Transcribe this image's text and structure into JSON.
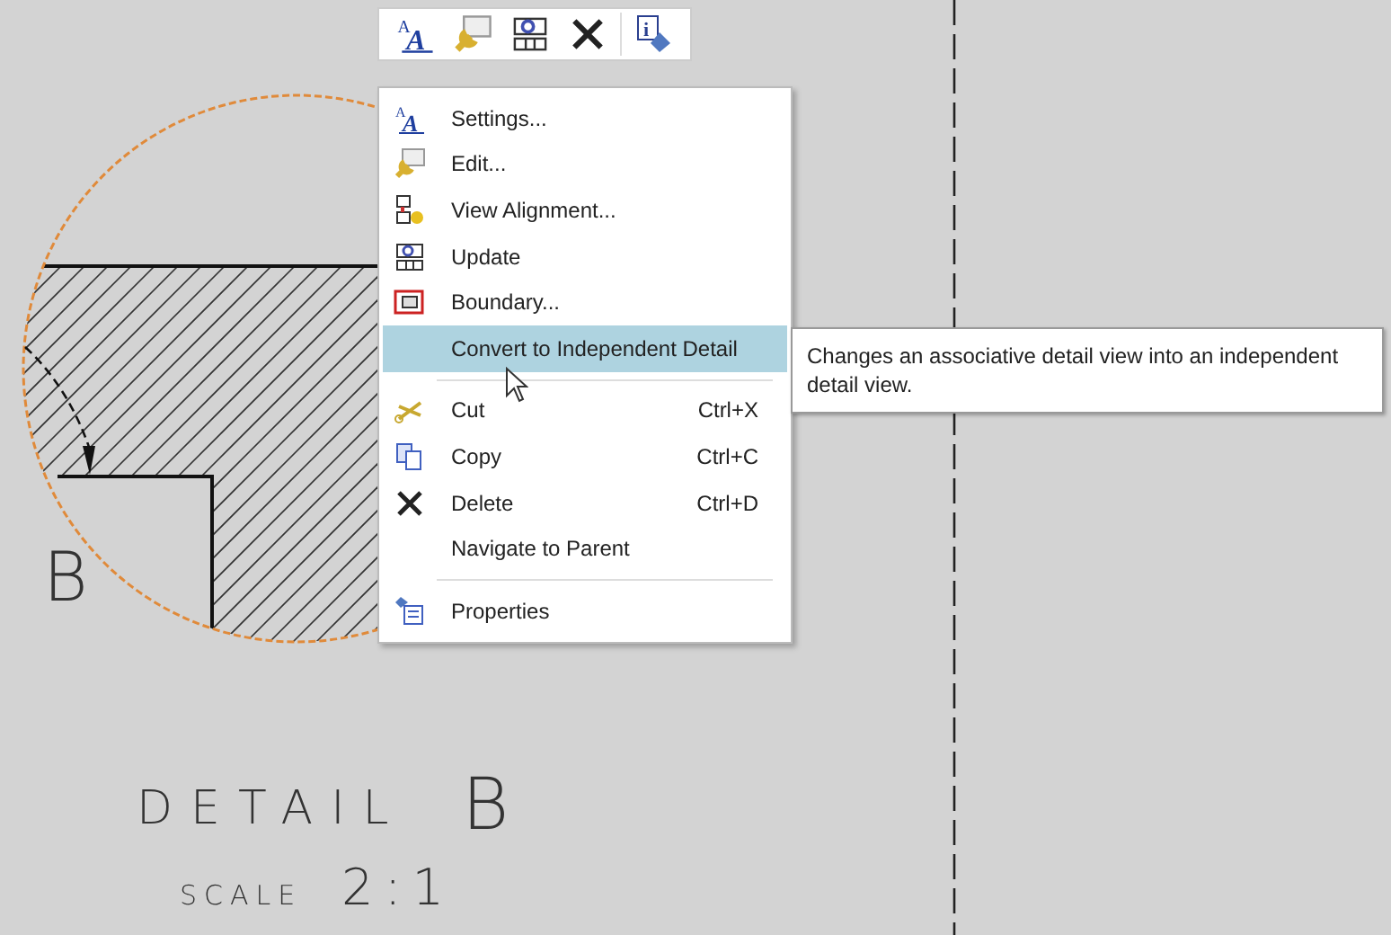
{
  "drawing": {
    "view_label": "B",
    "title_word": "DETAIL",
    "title_letter": "B",
    "scale_word": "SCALE",
    "scale_value": "2:1"
  },
  "mini_toolbar": {
    "buttons": [
      {
        "kind": "font",
        "letters": [
          "A",
          "A"
        ]
      },
      {
        "kind": "edit"
      },
      {
        "kind": "update"
      },
      {
        "kind": "delete"
      },
      {
        "kind": "info",
        "letters": [
          "i"
        ]
      }
    ]
  },
  "context_menu": {
    "items": [
      {
        "kind": "item",
        "label": "Settings...",
        "icon_letters": [
          "A",
          "A"
        ],
        "selected": false
      },
      {
        "kind": "item",
        "label": "Edit...",
        "selected": false
      },
      {
        "kind": "item",
        "label": "View Alignment...",
        "selected": false
      },
      {
        "kind": "item",
        "label": "Update",
        "selected": false
      },
      {
        "kind": "item",
        "label": "Boundary...",
        "selected": false
      },
      {
        "kind": "item",
        "label": "Convert to Independent Detail",
        "selected": true
      },
      {
        "kind": "separator"
      },
      {
        "kind": "item",
        "label": "Cut",
        "shortcut": "Ctrl+X",
        "selected": false
      },
      {
        "kind": "item",
        "label": "Copy",
        "shortcut": "Ctrl+C",
        "selected": false
      },
      {
        "kind": "item",
        "label": "Delete",
        "shortcut": "Ctrl+D",
        "selected": false
      },
      {
        "kind": "item",
        "label": "Navigate to Parent",
        "selected": false
      },
      {
        "kind": "separator"
      },
      {
        "kind": "item",
        "label": "Properties",
        "selected": false
      }
    ]
  },
  "tooltip": {
    "text": "Changes an associative detail view into an independent detail view."
  }
}
